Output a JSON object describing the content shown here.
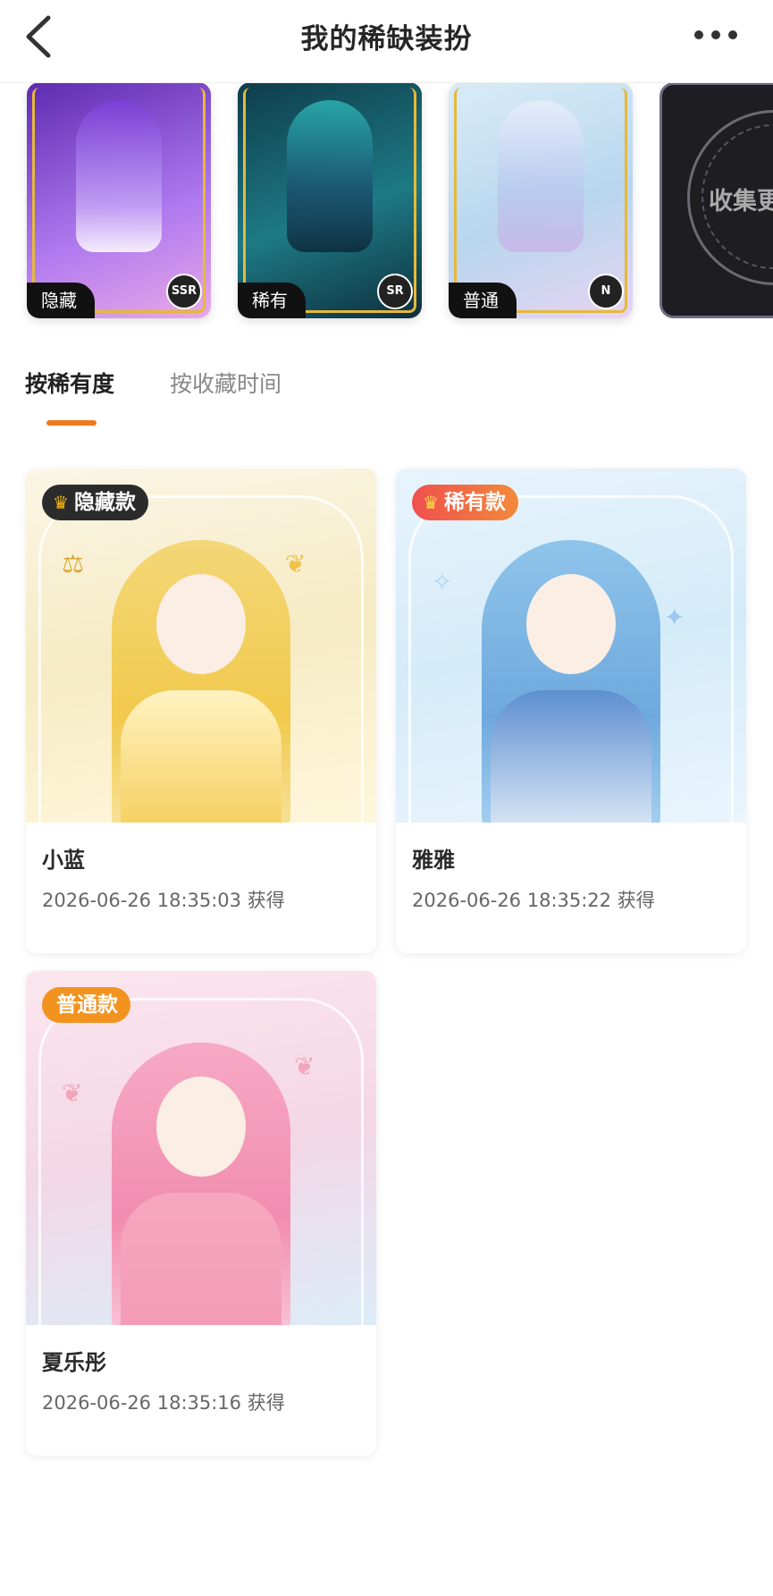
{
  "header": {
    "title": "我的稀缺装扮",
    "back_icon": "chevron-left-icon",
    "more_icon": "more-horizontal-icon"
  },
  "showcase": [
    {
      "label": "隐藏",
      "grade": "SSR",
      "theme": "#8a4fd8"
    },
    {
      "label": "稀有",
      "grade": "SR",
      "theme": "#1f6b74"
    },
    {
      "label": "普通",
      "grade": "N",
      "theme": "#bcd9ee"
    },
    {
      "label": "收集更"
    }
  ],
  "tabs": [
    {
      "label": "按稀有度",
      "active": true
    },
    {
      "label": "按收藏时间",
      "active": false
    }
  ],
  "accent_color": "#f07a1a",
  "items": [
    {
      "badge": "隐藏款",
      "badge_color": "#2b2b2b",
      "name": "小蓝",
      "time": "2026-06-26 18:35:03 获得"
    },
    {
      "badge": "稀有款",
      "badge_color": "#f0513a",
      "name": "雅雅",
      "time": "2026-06-26 18:35:22 获得"
    },
    {
      "badge": "普通款",
      "badge_color": "#f3931f",
      "name": "夏乐彤",
      "time": "2026-06-26 18:35:16 获得"
    }
  ]
}
